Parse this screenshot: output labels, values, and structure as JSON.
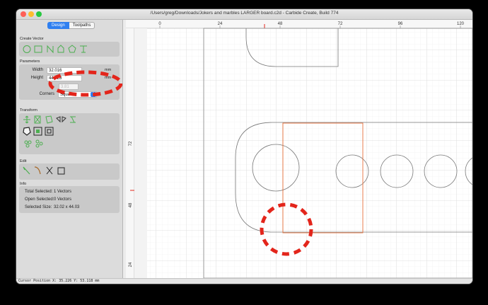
{
  "window": {
    "title": "/Users/greg/Downloads/Jokers and marbles LARGER board.c2d - Carbide Create, Build 774"
  },
  "tabs": [
    {
      "label": "Design",
      "active": true
    },
    {
      "label": "Toolpaths",
      "active": false
    }
  ],
  "create_vector": {
    "title": "Create Vector",
    "tools": [
      "circle-tool-icon",
      "rectangle-tool-icon",
      "curve-tool-icon",
      "polygon-tool-icon",
      "star-polygon-tool-icon",
      "text-tool-icon"
    ]
  },
  "parameters": {
    "title": "Parameters",
    "width_label": "Width",
    "width_value": "32.016",
    "width_unit": "mm",
    "height_label": "Height",
    "height_value": "44.028",
    "height_unit": "mm",
    "radius_value": "3.81",
    "corners_label": "Corners",
    "corners_value": "Square"
  },
  "transform": {
    "title": "Transform"
  },
  "edit": {
    "title": "Edit"
  },
  "info": {
    "title": "Info",
    "rows": [
      {
        "label": "Total Selected:",
        "value": "1 Vectors"
      },
      {
        "label": "Open Selected:",
        "value": "0 Vectors"
      },
      {
        "label": "Selected Size:",
        "value": "32.02 x 44.03"
      }
    ]
  },
  "ruler": {
    "top_labels": [
      "0",
      "24",
      "48",
      "72",
      "96",
      "120"
    ],
    "left_labels": [
      "72",
      "48",
      "24"
    ]
  },
  "status": {
    "cursor_position": "Cursor Position X: 35.226 Y: 53.118 mm"
  },
  "colors": {
    "accent": "#2f7ff0",
    "selection": "#e8703a",
    "annotation": "#e3251b",
    "tool_green": "#4caf50"
  }
}
